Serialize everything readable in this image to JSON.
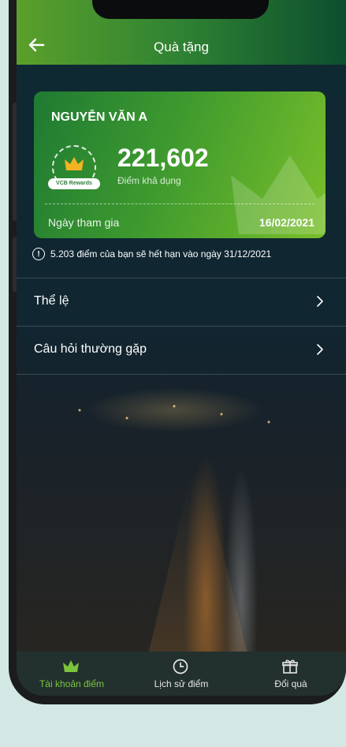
{
  "header": {
    "title": "Quà tặng"
  },
  "card": {
    "holder_name": "NGUYỄN VĂN A",
    "badge_label": "VCB Rewards",
    "points": "221,602",
    "points_label": "Điểm khả dụng",
    "join_label": "Ngày tham gia",
    "join_date": "16/02/2021"
  },
  "notice": {
    "text": "5.203 điểm của bạn sẽ hết hạn vào ngày 31/12/2021"
  },
  "menu": [
    {
      "label": "Thể lệ"
    },
    {
      "label": "Câu hỏi thường gặp"
    }
  ],
  "tabs": [
    {
      "label": "Tài khoản điểm",
      "icon": "crown-icon",
      "active": true
    },
    {
      "label": "Lịch sử điểm",
      "icon": "clock-icon",
      "active": false
    },
    {
      "label": "Đổi quà",
      "icon": "gift-icon",
      "active": false
    }
  ],
  "colors": {
    "accent": "#7bc43b",
    "header_start": "#5aa02a",
    "header_end": "#0c4e2e"
  }
}
